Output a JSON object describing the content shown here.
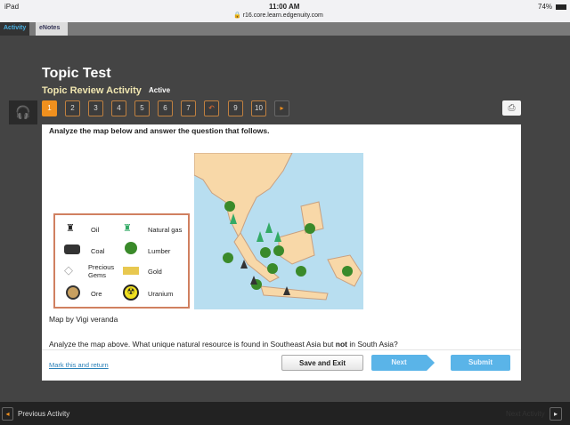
{
  "status": {
    "device": "iPad",
    "time": "11:00 AM",
    "url": "r16.core.learn.edgenuity.com",
    "battery": "74%"
  },
  "tabs": [
    "Activity",
    "eNotes"
  ],
  "header": {
    "title": "Topic Test",
    "subtitle": "Topic Review Activity",
    "state": "Active"
  },
  "questions": [
    "1",
    "2",
    "3",
    "4",
    "5",
    "6",
    "7",
    "",
    "9",
    "10"
  ],
  "question": {
    "instruction": "Analyze the map below and answer the question that follows.",
    "caption": "Map by Vigi veranda",
    "prompt_pre": "Analyze the map above. What unique natural resource is found in Southeast Asia but ",
    "prompt_bold": "not",
    "prompt_post": " in South Asia?"
  },
  "legend": [
    "Oil",
    "Natural gas",
    "Coal",
    "Lumber",
    "Precious Gems",
    "Gold",
    "Ore",
    "Uranium"
  ],
  "actions": {
    "mark": "Mark this and return",
    "save": "Save and Exit",
    "next": "Next",
    "submit": "Submit"
  },
  "footer": {
    "prev": "Previous Activity",
    "next": "Next Activity"
  },
  "colors": {
    "accent": "#f0901e",
    "button_blue": "#4aa8e0"
  }
}
